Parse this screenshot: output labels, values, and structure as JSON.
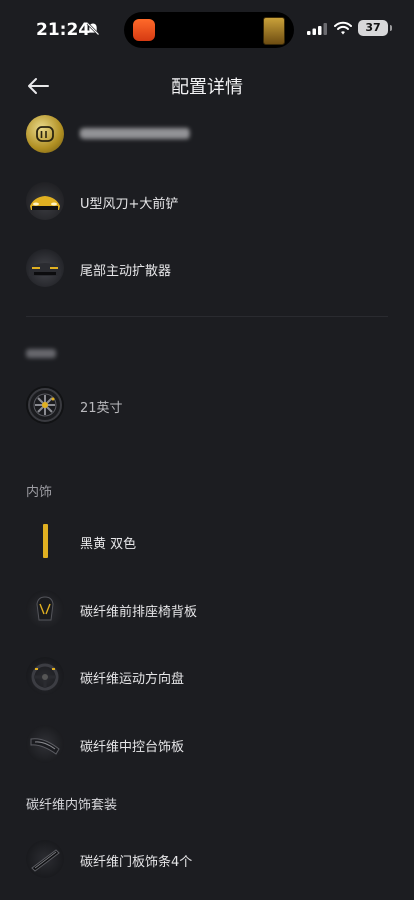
{
  "status_bar": {
    "time": "21:24",
    "battery": "37"
  },
  "header": {
    "title": "配置详情"
  },
  "exterior_items": [
    {
      "label": "U型风刀+大前铲"
    },
    {
      "label": "尾部主动扩散器"
    }
  ],
  "wheel_item": {
    "label": "21英寸"
  },
  "interior_section": {
    "title": "内饰"
  },
  "interior_items": [
    {
      "label": "黑黄 双色"
    },
    {
      "label": "碳纤维前排座椅背板"
    },
    {
      "label": "碳纤维运动方向盘"
    },
    {
      "label": "碳纤维中控台饰板"
    }
  ],
  "carbon_kit_section": {
    "title": "碳纤维内饰套装"
  },
  "carbon_kit_items": [
    {
      "label": "碳纤维门板饰条4个"
    }
  ],
  "colors": {
    "accent_yellow": "#e0b021",
    "background": "#1c1d21"
  }
}
